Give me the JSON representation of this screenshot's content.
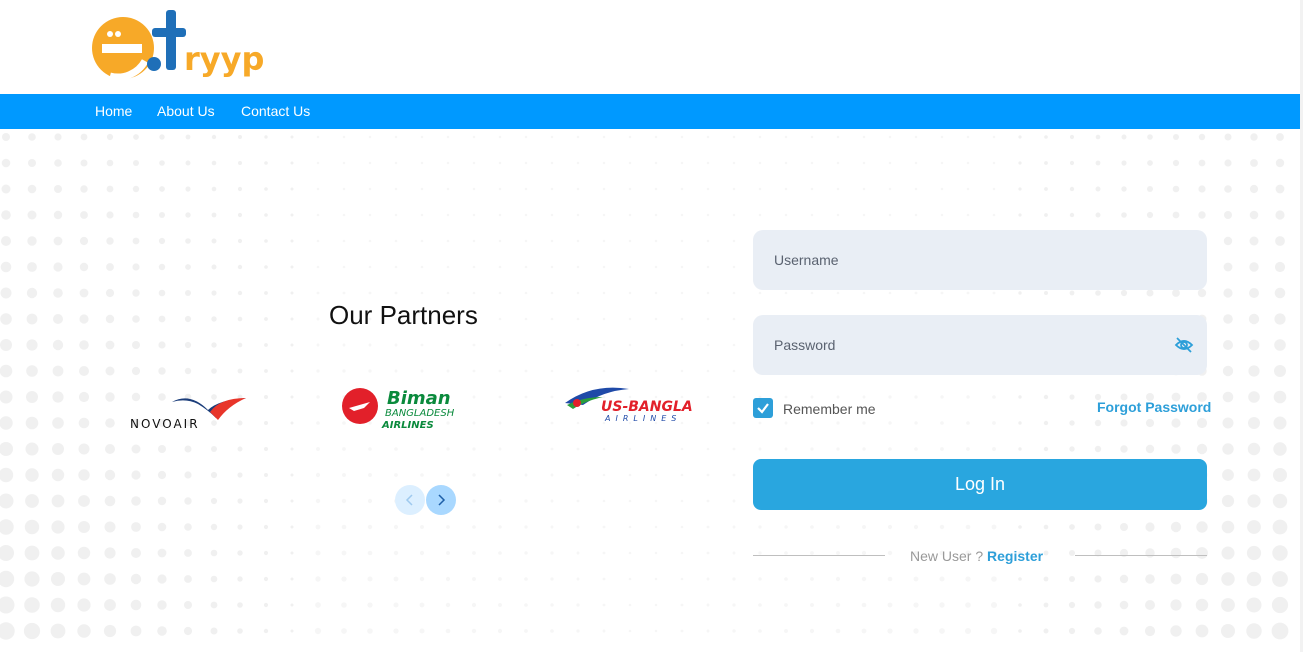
{
  "brand": {
    "logo_text": "etryyp",
    "colors": {
      "orange": "#f7a928",
      "blue": "#1f6fb8",
      "nav": "#0099ff",
      "accent": "#2d9fd9"
    }
  },
  "nav": {
    "items": [
      {
        "label": "Home"
      },
      {
        "label": "About Us"
      },
      {
        "label": "Contact Us"
      }
    ]
  },
  "partners": {
    "title": "Our Partners",
    "logos": [
      {
        "name": "NOVOAIR"
      },
      {
        "name": "Biman",
        "sub1": "BANGLADESH",
        "sub2": "AIRLINES"
      },
      {
        "name": "US-BANGLA",
        "sub": "AIRLINES"
      }
    ],
    "prev_icon": "chevron-left-icon",
    "next_icon": "chevron-right-icon"
  },
  "login": {
    "username_placeholder": "Username",
    "username_value": "",
    "password_placeholder": "Password",
    "password_value": "",
    "password_toggle_icon": "eye-slash-icon",
    "remember_label": "Remember me",
    "remember_checked": true,
    "forgot_label": "Forgot Password",
    "login_label": "Log In",
    "new_user_label": "New User ?",
    "register_label": "Register"
  }
}
